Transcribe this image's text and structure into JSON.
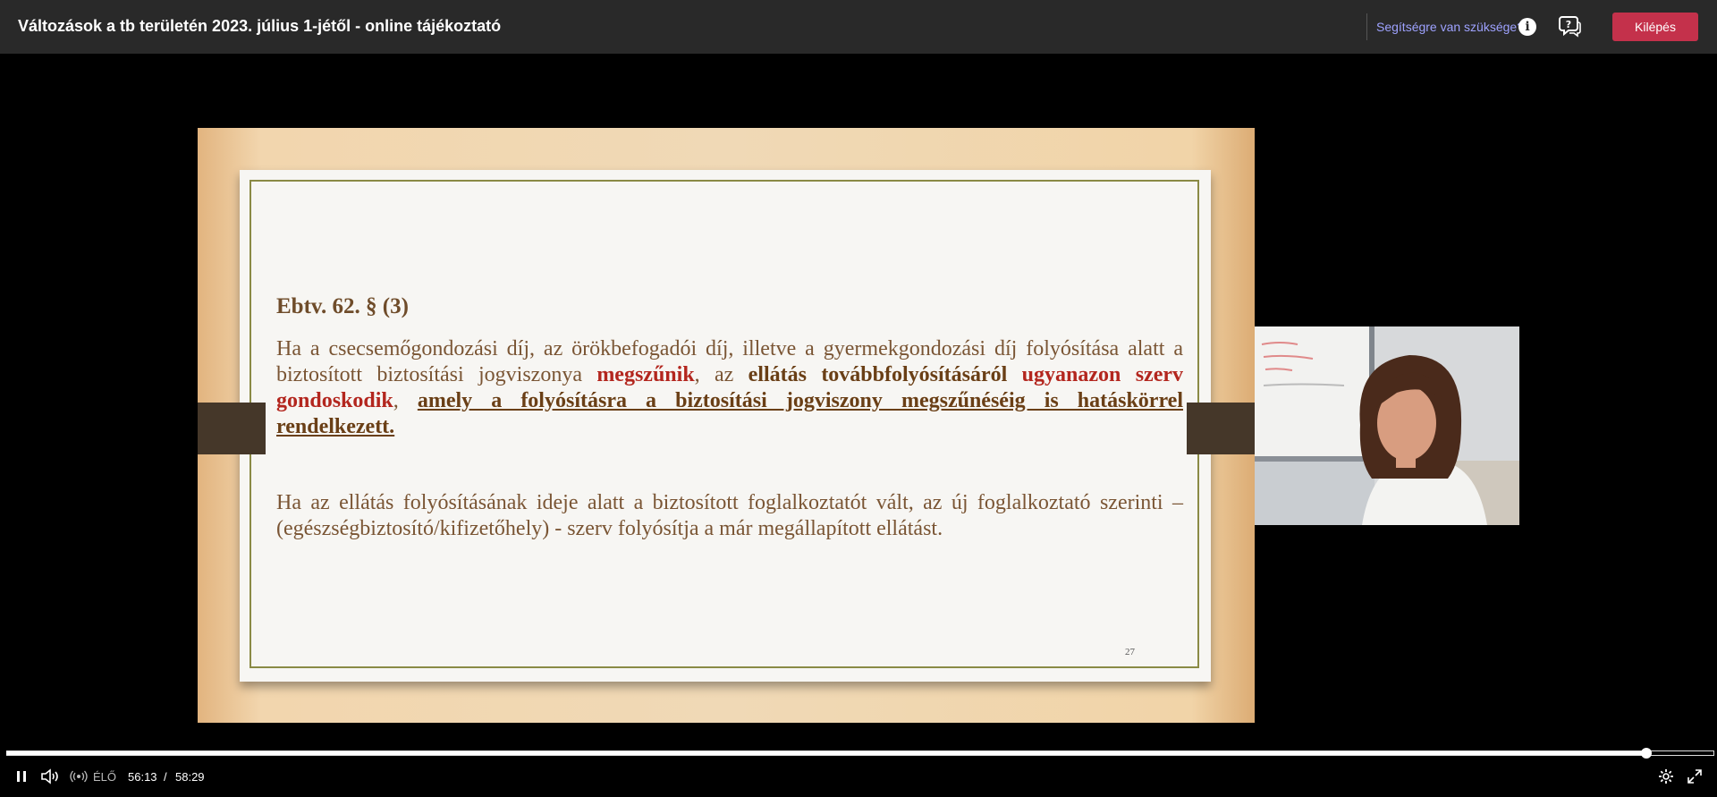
{
  "header": {
    "title": "Változások a tb területén 2023. július 1-jétől - online tájékoztató",
    "help_link": "Segítségre van szüksége?",
    "info_glyph": "i",
    "exit_button": "Kilépés"
  },
  "slide": {
    "heading": "Ebtv. 62. § (3)",
    "para1": {
      "t1": "Ha a csecsemőgondozási díj, az örökbefogadói díj, illetve a gyermekgondozási díj folyósítása alatt a biztosított biztosítási jogviszonya ",
      "t2": "megszűnik",
      "t3": ", az ",
      "t4": "ellátás továbbfolyósításáról",
      "t5": " ",
      "t6": "ugyanazon szerv gondoskodik",
      "t7": ", ",
      "t8": "amely a folyósításra a biztosítási jogviszony megszűnéséig is hatáskörrel rendelkezett."
    },
    "para2": "Ha az ellátás folyósításának ideje alatt a biztosított foglalkoztatót vált, az új foglalkoztató szerinti – (egészségbiztosító/kifizetőhely) - szerv folyósítja a már megállapított ellátást.",
    "page_number": "27"
  },
  "player": {
    "live_label": "ÉLŐ",
    "current_time": "56:13",
    "separator": "/",
    "duration": "58:29",
    "progress_fraction": 0.961
  },
  "icons": {
    "play_pause": "pause-icon",
    "volume": "volume-icon",
    "live": "live-broadcast-icon",
    "settings": "gear-icon",
    "fullscreen": "expand-icon",
    "chat": "chat-help-icon",
    "info": "info-icon"
  },
  "colors": {
    "topbar": "#292929",
    "exit_button": "#c4314b",
    "help_link": "#9ea2ff",
    "slide_red": "#b3261e",
    "slide_brown": "#7a5534"
  }
}
